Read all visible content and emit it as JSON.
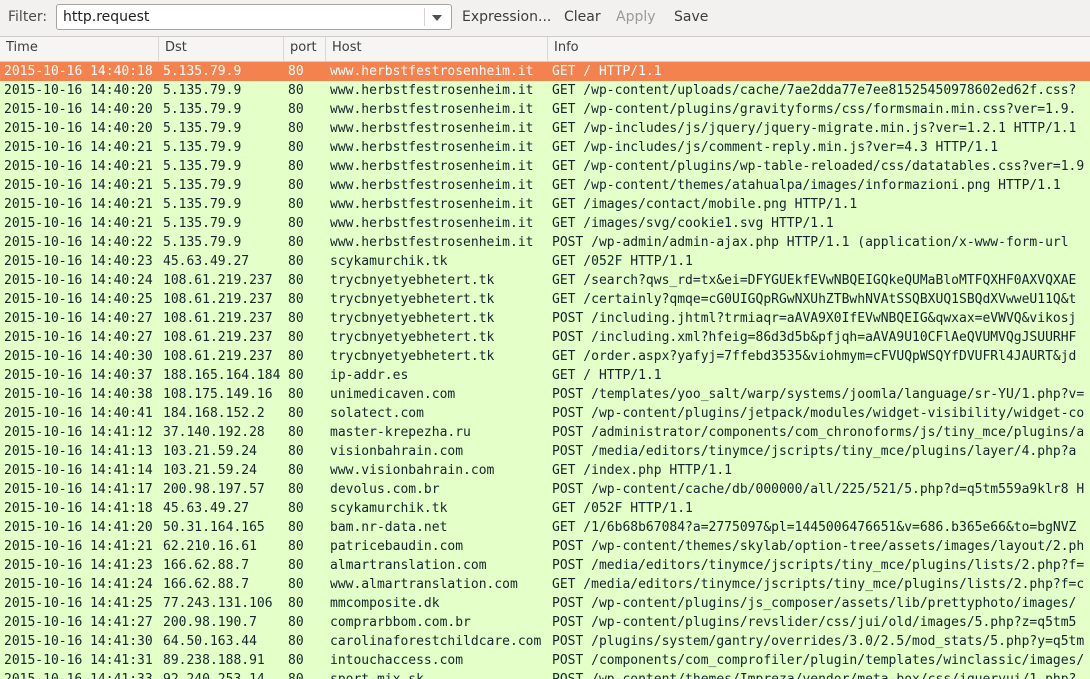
{
  "filter_bar": {
    "label": "Filter:",
    "value": "http.request",
    "expression_label": "Expression...",
    "clear_label": "Clear",
    "apply_label": "Apply",
    "save_label": "Save",
    "dropdown_icon": "chevron-down-icon"
  },
  "columns": [
    "Time",
    "Dst",
    "port",
    "Host",
    "Info"
  ],
  "colors": {
    "row_background": "#e4ffc7",
    "selected_row": "#f4824e"
  },
  "selected_index": 0,
  "rows": [
    {
      "time": "2015-10-16 14:40:18",
      "dst": "5.135.79.9",
      "port": "80",
      "host": "www.herbstfestrosenheim.it",
      "info": "GET / HTTP/1.1"
    },
    {
      "time": "2015-10-16 14:40:20",
      "dst": "5.135.79.9",
      "port": "80",
      "host": "www.herbstfestrosenheim.it",
      "info": "GET /wp-content/uploads/cache/7ae2dda77e7ee81525450978602ed62f.css?"
    },
    {
      "time": "2015-10-16 14:40:20",
      "dst": "5.135.79.9",
      "port": "80",
      "host": "www.herbstfestrosenheim.it",
      "info": "GET /wp-content/plugins/gravityforms/css/formsmain.min.css?ver=1.9."
    },
    {
      "time": "2015-10-16 14:40:20",
      "dst": "5.135.79.9",
      "port": "80",
      "host": "www.herbstfestrosenheim.it",
      "info": "GET /wp-includes/js/jquery/jquery-migrate.min.js?ver=1.2.1 HTTP/1.1"
    },
    {
      "time": "2015-10-16 14:40:21",
      "dst": "5.135.79.9",
      "port": "80",
      "host": "www.herbstfestrosenheim.it",
      "info": "GET /wp-includes/js/comment-reply.min.js?ver=4.3 HTTP/1.1"
    },
    {
      "time": "2015-10-16 14:40:21",
      "dst": "5.135.79.9",
      "port": "80",
      "host": "www.herbstfestrosenheim.it",
      "info": "GET /wp-content/plugins/wp-table-reloaded/css/datatables.css?ver=1.9"
    },
    {
      "time": "2015-10-16 14:40:21",
      "dst": "5.135.79.9",
      "port": "80",
      "host": "www.herbstfestrosenheim.it",
      "info": "GET /wp-content/themes/atahualpa/images/informazioni.png HTTP/1.1"
    },
    {
      "time": "2015-10-16 14:40:21",
      "dst": "5.135.79.9",
      "port": "80",
      "host": "www.herbstfestrosenheim.it",
      "info": "GET /images/contact/mobile.png HTTP/1.1"
    },
    {
      "time": "2015-10-16 14:40:21",
      "dst": "5.135.79.9",
      "port": "80",
      "host": "www.herbstfestrosenheim.it",
      "info": "GET /images/svg/cookie1.svg HTTP/1.1"
    },
    {
      "time": "2015-10-16 14:40:22",
      "dst": "5.135.79.9",
      "port": "80",
      "host": "www.herbstfestrosenheim.it",
      "info": "POST /wp-admin/admin-ajax.php HTTP/1.1  (application/x-www-form-url"
    },
    {
      "time": "2015-10-16 14:40:23",
      "dst": "45.63.49.27",
      "port": "80",
      "host": "scykamurchik.tk",
      "info": "GET /052F HTTP/1.1"
    },
    {
      "time": "2015-10-16 14:40:24",
      "dst": "108.61.219.237",
      "port": "80",
      "host": "trycbnyetyebhetert.tk",
      "info": "GET /search?qws_rd=tx&ei=DFYGUEkfEVwNBQEIGQkeQUMaBloMTFQXHF0AXVQXAE"
    },
    {
      "time": "2015-10-16 14:40:25",
      "dst": "108.61.219.237",
      "port": "80",
      "host": "trycbnyetyebhetert.tk",
      "info": "GET /certainly?qmqe=cG0UIGQpRGwNXUhZTBwhNVAtSSQBXUQ1SBQdXVwweU11Q&t"
    },
    {
      "time": "2015-10-16 14:40:27",
      "dst": "108.61.219.237",
      "port": "80",
      "host": "trycbnyetyebhetert.tk",
      "info": "POST /including.jhtml?trmiaqr=aAVA9X0IfEVwNBQEIG&qwxax=eVWVQ&vikosj"
    },
    {
      "time": "2015-10-16 14:40:27",
      "dst": "108.61.219.237",
      "port": "80",
      "host": "trycbnyetyebhetert.tk",
      "info": "POST /including.xml?hfeig=86d3d5b&pfjqh=aAVA9U10CFlAeQVUMVQgJSUURHF"
    },
    {
      "time": "2015-10-16 14:40:30",
      "dst": "108.61.219.237",
      "port": "80",
      "host": "trycbnyetyebhetert.tk",
      "info": "GET /order.aspx?yafyj=7ffebd3535&viohmym=cFVUQpWSQYfDVUFRl4JAURT&jd"
    },
    {
      "time": "2015-10-16 14:40:37",
      "dst": "188.165.164.184",
      "port": "80",
      "host": "ip-addr.es",
      "info": "GET / HTTP/1.1"
    },
    {
      "time": "2015-10-16 14:40:38",
      "dst": "108.175.149.16",
      "port": "80",
      "host": "unimedicaven.com",
      "info": "POST /templates/yoo_salt/warp/systems/joomla/language/sr-YU/1.php?v="
    },
    {
      "time": "2015-10-16 14:40:41",
      "dst": "184.168.152.2",
      "port": "80",
      "host": "solatect.com",
      "info": "POST /wp-content/plugins/jetpack/modules/widget-visibility/widget-co"
    },
    {
      "time": "2015-10-16 14:41:12",
      "dst": "37.140.192.28",
      "port": "80",
      "host": "master-krepezha.ru",
      "info": "POST /administrator/components/com_chronoforms/js/tiny_mce/plugins/a"
    },
    {
      "time": "2015-10-16 14:41:13",
      "dst": "103.21.59.24",
      "port": "80",
      "host": "visionbahrain.com",
      "info": "POST /media/editors/tinymce/jscripts/tiny_mce/plugins/layer/4.php?a"
    },
    {
      "time": "2015-10-16 14:41:14",
      "dst": "103.21.59.24",
      "port": "80",
      "host": "www.visionbahrain.com",
      "info": "GET /index.php HTTP/1.1"
    },
    {
      "time": "2015-10-16 14:41:17",
      "dst": "200.98.197.57",
      "port": "80",
      "host": "devolus.com.br",
      "info": "POST /wp-content/cache/db/000000/all/225/521/5.php?d=q5tm559a9klr8 H"
    },
    {
      "time": "2015-10-16 14:41:18",
      "dst": "45.63.49.27",
      "port": "80",
      "host": "scykamurchik.tk",
      "info": "GET /052F HTTP/1.1"
    },
    {
      "time": "2015-10-16 14:41:20",
      "dst": "50.31.164.165",
      "port": "80",
      "host": "bam.nr-data.net",
      "info": "GET /1/6b68b67084?a=2775097&pl=1445006476651&v=686.b365e66&to=bgNVZ"
    },
    {
      "time": "2015-10-16 14:41:21",
      "dst": "62.210.16.61",
      "port": "80",
      "host": "patricebaudin.com",
      "info": "POST /wp-content/themes/skylab/option-tree/assets/images/layout/2.ph"
    },
    {
      "time": "2015-10-16 14:41:23",
      "dst": "166.62.88.7",
      "port": "80",
      "host": "almartranslation.com",
      "info": "POST /media/editors/tinymce/jscripts/tiny_mce/plugins/lists/2.php?f="
    },
    {
      "time": "2015-10-16 14:41:24",
      "dst": "166.62.88.7",
      "port": "80",
      "host": "www.almartranslation.com",
      "info": "GET /media/editors/tinymce/jscripts/tiny_mce/plugins/lists/2.php?f=c"
    },
    {
      "time": "2015-10-16 14:41:25",
      "dst": "77.243.131.106",
      "port": "80",
      "host": "mmcomposite.dk",
      "info": "POST /wp-content/plugins/js_composer/assets/lib/prettyphoto/images/"
    },
    {
      "time": "2015-10-16 14:41:27",
      "dst": "200.98.190.7",
      "port": "80",
      "host": "comprarbbom.com.br",
      "info": "POST /wp-content/plugins/revslider/css/jui/old/images/5.php?z=q5tm5"
    },
    {
      "time": "2015-10-16 14:41:30",
      "dst": "64.50.163.44",
      "port": "80",
      "host": "carolinaforestchildcare.com",
      "info": "POST /plugins/system/gantry/overrides/3.0/2.5/mod_stats/5.php?y=q5tm"
    },
    {
      "time": "2015-10-16 14:41:31",
      "dst": "89.238.188.91",
      "port": "80",
      "host": "intouchaccess.com",
      "info": "POST /components/com_comprofiler/plugin/templates/winclassic/images/"
    },
    {
      "time": "2015-10-16 14:41:33",
      "dst": "92.240.253.14",
      "port": "80",
      "host": "sport-mix.sk",
      "info": "POST /wp-content/themes/Impreza/vendor/meta-box/css/jqueryui/1.php?"
    }
  ]
}
